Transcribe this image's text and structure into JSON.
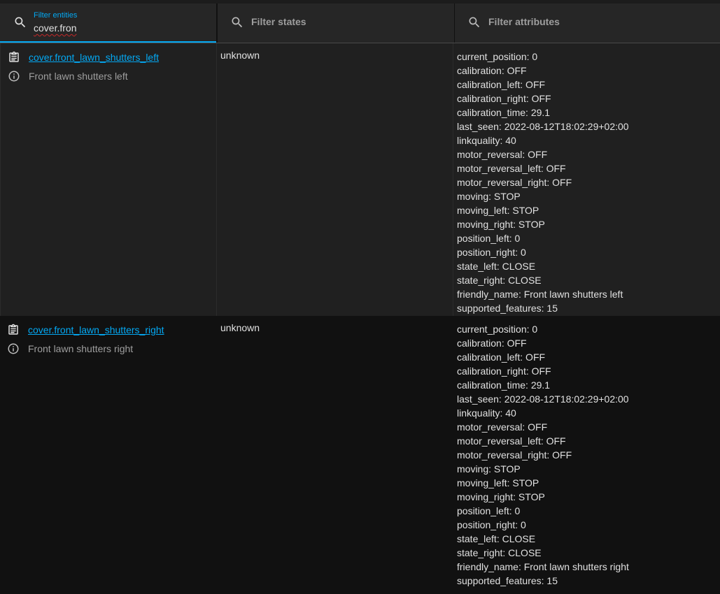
{
  "filters": {
    "entities": {
      "label": "Filter entities",
      "value": "cover.fron"
    },
    "states": {
      "placeholder": "Filter states"
    },
    "attributes": {
      "placeholder": "Filter attributes"
    }
  },
  "colors": {
    "accent": "#03a9f4",
    "text": "#e1e1e1",
    "muted": "#9e9e9e"
  },
  "rows": [
    {
      "entity_id": "cover.front_lawn_shutters_left",
      "friendly_name": "Front lawn shutters left",
      "state": "unknown",
      "attributes": [
        "current_position: 0",
        "calibration: OFF",
        "calibration_left: OFF",
        "calibration_right: OFF",
        "calibration_time: 29.1",
        "last_seen: 2022-08-12T18:02:29+02:00",
        "linkquality: 40",
        "motor_reversal: OFF",
        "motor_reversal_left: OFF",
        "motor_reversal_right: OFF",
        "moving: STOP",
        "moving_left: STOP",
        "moving_right: STOP",
        "position_left: 0",
        "position_right: 0",
        "state_left: CLOSE",
        "state_right: CLOSE",
        "friendly_name: Front lawn shutters left",
        "supported_features: 15"
      ]
    },
    {
      "entity_id": "cover.front_lawn_shutters_right",
      "friendly_name": "Front lawn shutters right",
      "state": "unknown",
      "attributes": [
        "current_position: 0",
        "calibration: OFF",
        "calibration_left: OFF",
        "calibration_right: OFF",
        "calibration_time: 29.1",
        "last_seen: 2022-08-12T18:02:29+02:00",
        "linkquality: 40",
        "motor_reversal: OFF",
        "motor_reversal_left: OFF",
        "motor_reversal_right: OFF",
        "moving: STOP",
        "moving_left: STOP",
        "moving_right: STOP",
        "position_left: 0",
        "position_right: 0",
        "state_left: CLOSE",
        "state_right: CLOSE",
        "friendly_name: Front lawn shutters right",
        "supported_features: 15"
      ]
    }
  ]
}
